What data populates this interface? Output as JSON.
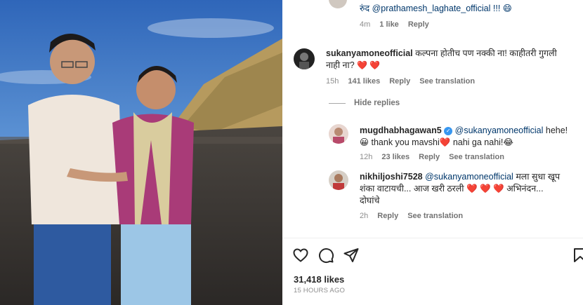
{
  "post": {
    "photo_alt": "",
    "likes": "31,418 likes",
    "time_ago": "15 HOURS AGO"
  },
  "comments": {
    "top_partial": {
      "text_partial": "रुंद @prathamesh_laghate_official !!! 😄",
      "time": "4m",
      "likes": "1 like",
      "reply": "Reply"
    },
    "main": {
      "username": "sukanyamoneofficial",
      "text": "कल्पना होतीच पण नक्की ना! काहीतरी गुगली नाही ना?",
      "hearts": "❤️ ❤️",
      "time": "15h",
      "likes": "141 likes",
      "reply": "Reply",
      "translation": "See translation"
    },
    "hide_replies": "Hide replies",
    "replies": [
      {
        "username": "mugdhabhagawan5",
        "mention": "@sukanyamoneofficial",
        "line1": "hehe!",
        "line2": "😀 thank you mavshi❤️ nahi ga nahi!😂",
        "time": "12h",
        "likes": "23 likes",
        "reply": "Reply",
        "translation": "See translation"
      },
      {
        "username": "nikhiljoshi7528",
        "mention": "@sukanyamoneofficial",
        "line1": "मला सुधा खूप",
        "line2": "शंका वाटायची... आज खरी ठरली ❤️ ❤️ ❤️ अभिनंदन...",
        "line3": "दोघांचे",
        "time": "2h",
        "reply": "Reply",
        "translation": "See translation"
      }
    ]
  },
  "icons": {
    "like": "heart-outline-icon",
    "comment": "comment-bubble-icon",
    "share": "paper-plane-icon",
    "save": "bookmark-icon",
    "verified": "verified-badge-icon"
  },
  "colors": {
    "link": "#00376b",
    "heart": "#ed1c3c",
    "muted": "#8e8e8e",
    "verified": "#3897f0"
  }
}
